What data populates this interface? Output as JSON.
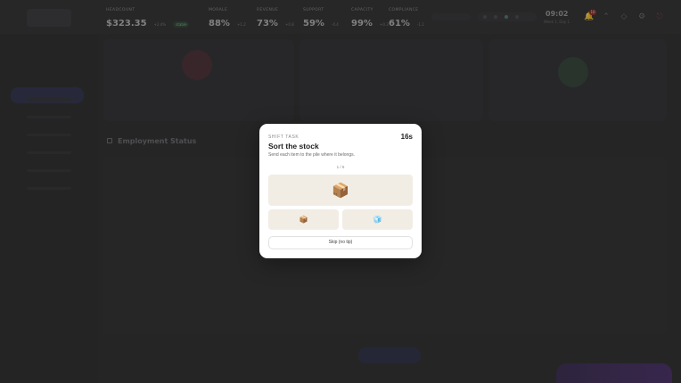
{
  "topbar": {
    "stats": [
      {
        "label": "HEADCOUNT",
        "value": "$323.35",
        "delta": "+2.4%",
        "pill": "stable"
      },
      {
        "label": "MORALE",
        "value": "88%",
        "delta": "+1.2"
      },
      {
        "label": "REVENUE",
        "value": "73%",
        "delta": "+0.8"
      },
      {
        "label": "SUPPORT",
        "value": "59%",
        "delta": "-0.4"
      },
      {
        "label": "CAPACITY",
        "value": "99%",
        "delta": "+0.3"
      },
      {
        "label": "COMPLIANCE",
        "value": "61%",
        "delta": "-1.1"
      }
    ],
    "clock": "09:02",
    "clock_sub": "Week 1, Day 1",
    "notifications_count": "10"
  },
  "background": {
    "employment_title": "Employment Status"
  },
  "modal": {
    "kicker": "SHIFT TASK",
    "timer": "16s",
    "title": "Sort the stock",
    "subtitle": "Send each item to the pile where it belongs.",
    "progress": "1 / 6",
    "current_item": "📦",
    "piles": [
      {
        "icon": "📦",
        "name": "box-pile"
      },
      {
        "icon": "🧊",
        "name": "ice-pile"
      }
    ],
    "skip_label": "Skip (no tip)"
  }
}
